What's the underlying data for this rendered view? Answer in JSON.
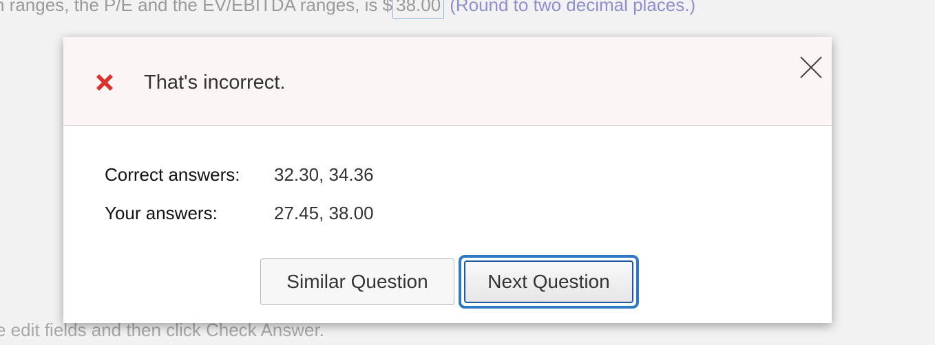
{
  "background": {
    "question_text": "n ranges, the P/E and the EV/EBITDA ranges, is $",
    "answer_value": "38.00",
    "hint_text": "(Round to two decimal places.)",
    "instruction_text": "e edit fields and then click Check Answer."
  },
  "dialog": {
    "header_text": "That's incorrect.",
    "status_color": "#d9322c",
    "correct_label": "Correct answers:",
    "correct_values": "32.30, 34.36",
    "your_label": "Your answers:",
    "your_values": "27.45, 38.00",
    "similar_button_label": "Similar Question",
    "next_button_label": "Next Question",
    "focus_color": "#2f78c4"
  }
}
